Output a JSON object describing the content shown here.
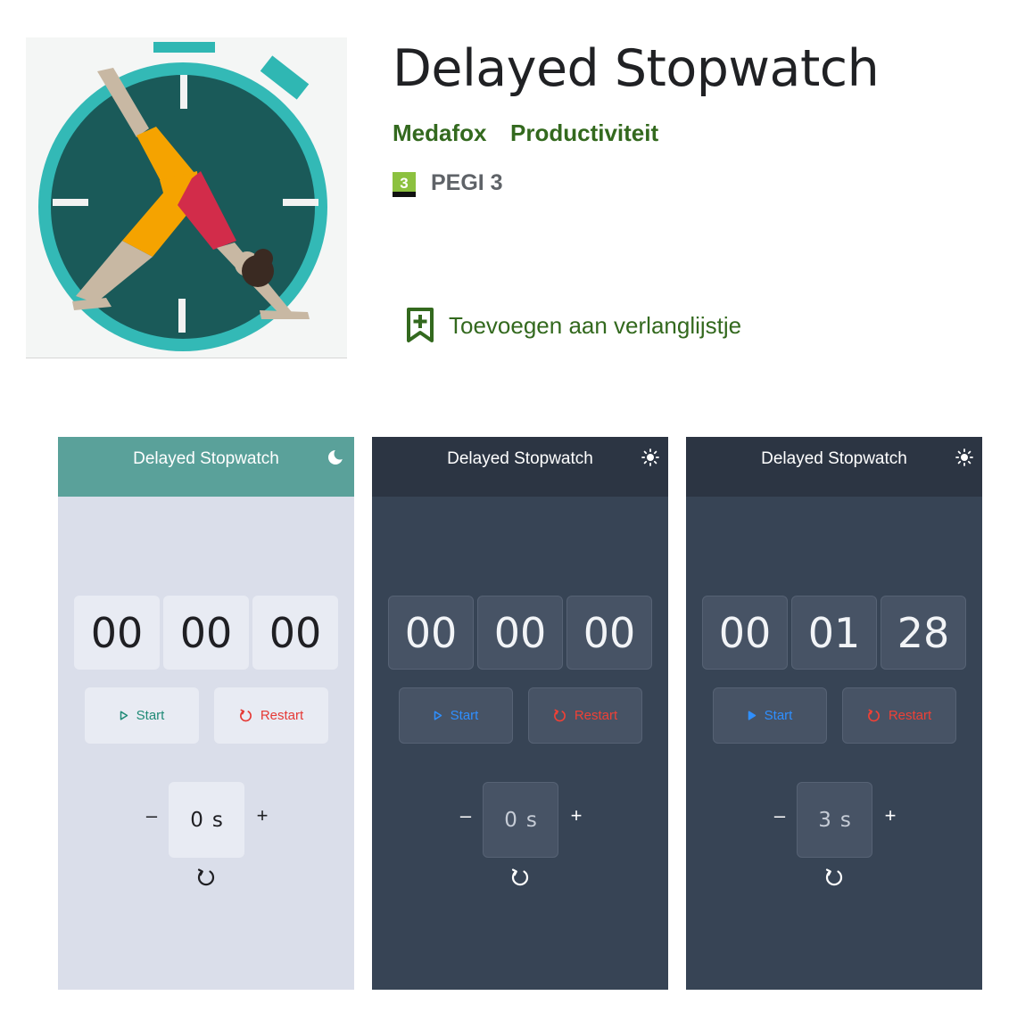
{
  "app": {
    "title": "Delayed Stopwatch",
    "developer": "Medafox",
    "category": "Productiviteit",
    "rating_label": "PEGI 3",
    "rating_number": "3",
    "wishlist_label": "Toevoegen aan verlanglijstje"
  },
  "screenshots": [
    {
      "theme": "light",
      "theme_icon": "moon-icon",
      "title": "Delayed Stopwatch",
      "digits": [
        "00",
        "00",
        "00"
      ],
      "start_label": "Start",
      "restart_label": "Restart",
      "minus_label": "–",
      "plus_label": "+",
      "delay_value": "0",
      "delay_unit": "s"
    },
    {
      "theme": "dark",
      "theme_icon": "sun-icon",
      "title": "Delayed Stopwatch",
      "digits": [
        "00",
        "00",
        "00"
      ],
      "start_label": "Start",
      "restart_label": "Restart",
      "minus_label": "–",
      "plus_label": "+",
      "delay_value": "0",
      "delay_unit": "s"
    },
    {
      "theme": "dark",
      "theme_icon": "sun-icon",
      "title": "Delayed Stopwatch",
      "digits": [
        "00",
        "01",
        "28"
      ],
      "start_label": "Start",
      "restart_label": "Restart",
      "minus_label": "–",
      "plus_label": "+",
      "delay_value": "3",
      "delay_unit": "s"
    }
  ],
  "colors": {
    "brand_green": "#33691e",
    "light_header": "#5aa19a",
    "light_body": "#dadeea",
    "dark_header": "#2c3543",
    "dark_body": "#374455",
    "start_light": "#1f8a76",
    "start_dark": "#2f8fff",
    "restart": "#e53935"
  },
  "icons": {
    "app_icon": "stopwatch-yoga-logo",
    "wishlist": "bookmark-add-icon",
    "play": "play-icon",
    "restart": "restart-icon",
    "reset": "reset-icon"
  }
}
